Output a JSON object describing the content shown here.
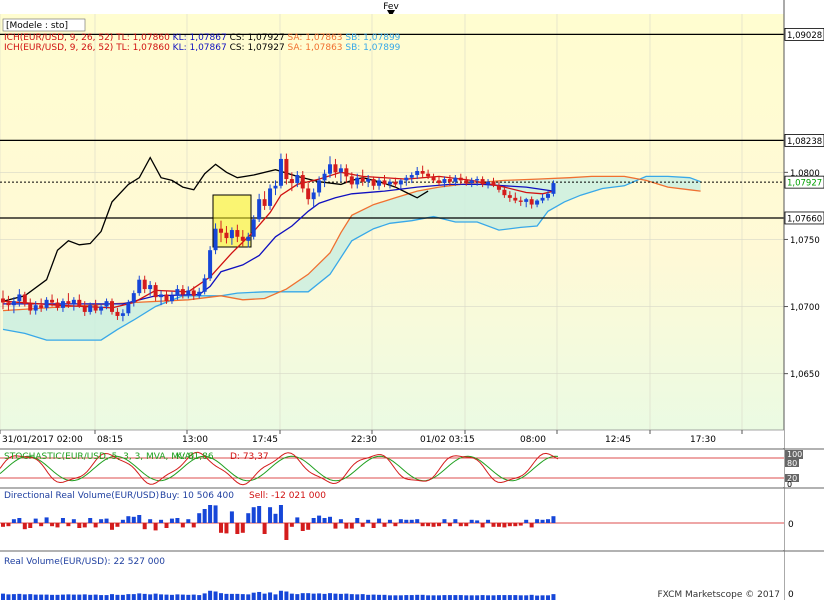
{
  "header": {
    "period_label": "Fev"
  },
  "legend": {
    "title": "[Modele : sto]",
    "line1": [
      {
        "text": "ICH(EUR/USD, 9, 26, 52)",
        "color": "#d01010"
      },
      {
        "text": "TL: 1,07860",
        "color": "#d01010"
      },
      {
        "text": "KL: 1,07867",
        "color": "#1010c0"
      },
      {
        "text": "CS: 1,07927",
        "color": "#000000"
      },
      {
        "text": "SA: 1,07863",
        "color": "#f07030"
      },
      {
        "text": "SB: 1,07899",
        "color": "#38a8e8"
      }
    ],
    "line2": [
      {
        "text": "ICH(EUR/USD, 9, 26, 52)",
        "color": "#d01010"
      },
      {
        "text": "TL: 1,07860",
        "color": "#d01010"
      },
      {
        "text": "KL: 1,07867",
        "color": "#1010c0"
      },
      {
        "text": "CS: 1,07927",
        "color": "#000000"
      },
      {
        "text": "SA: 1,07863",
        "color": "#f07030"
      },
      {
        "text": "SB: 1,07899",
        "color": "#38a8e8"
      }
    ]
  },
  "price_axis": {
    "ticks": [
      "1,0800",
      "1,0750",
      "1,0700",
      "1,0650"
    ],
    "tick_values": [
      1.08,
      1.075,
      1.07,
      1.065
    ],
    "markers": [
      {
        "label": "1,09028",
        "value": 1.09028,
        "style": "solid",
        "text_color": "#000000"
      },
      {
        "label": "1,08238",
        "value": 1.08238,
        "style": "solid",
        "text_color": "#000000"
      },
      {
        "label": "1,07927",
        "value": 1.07927,
        "style": "dotted",
        "text_color": "#00a000"
      },
      {
        "label": "1,07660",
        "value": 1.0766,
        "style": "solid",
        "text_color": "#000000"
      }
    ],
    "ylim": [
      1.0608,
      1.0918
    ]
  },
  "time_axis": {
    "labels": [
      "31/01/2017 02:00",
      "08:15",
      "13:00",
      "17:45",
      "22:30",
      "01/02 03:15",
      "08:00",
      "12:45",
      "17:30"
    ]
  },
  "stochastic": {
    "label": "STOCHASTIC(EUR/USD, 5, 3, 3, MVA, MVA)",
    "k_text": "K: 81,86",
    "d_text": "D: 73,37",
    "levels": [
      "100",
      "80",
      "20",
      "0"
    ]
  },
  "directional_volume": {
    "label": "Directional Real Volume(EUR/USD)",
    "buy_text": "Buy: 10 506 400",
    "sell_text": "Sell: -12 021 000",
    "zero_label": "0"
  },
  "real_volume": {
    "label": "Real Volume(EUR/USD): 22 527 000",
    "zero_label": "0"
  },
  "footer": {
    "copyright": "FXCM Marketscope © 2017"
  },
  "colors": {
    "bull": "#1646d8",
    "bear": "#d41c1c",
    "tenkan": "#d01010",
    "kijun": "#1010c0",
    "chikou": "#000000",
    "span_a": "#f07030",
    "span_b": "#38a8e8",
    "cloud": "#cbeee0",
    "bg_top": "#fffdd0",
    "bg_bottom": "#e9fbe4",
    "stoch_k": "#d41c1c",
    "stoch_d": "#20a020"
  },
  "chart_data": {
    "type": "candlestick",
    "symbol": "EUR/USD",
    "ylim": [
      1.0608,
      1.0918
    ],
    "candles": [
      [
        1.0706,
        1.0712,
        1.0698,
        1.0703
      ],
      [
        1.0703,
        1.0708,
        1.0697,
        1.0701
      ],
      [
        1.0701,
        1.0707,
        1.0695,
        1.0704
      ],
      [
        1.0704,
        1.0713,
        1.07,
        1.0709
      ],
      [
        1.0709,
        1.0711,
        1.07,
        1.0702
      ],
      [
        1.0702,
        1.0706,
        1.0694,
        1.0697
      ],
      [
        1.0697,
        1.0704,
        1.0694,
        1.0701
      ],
      [
        1.0701,
        1.0706,
        1.0696,
        1.0699
      ],
      [
        1.0699,
        1.0707,
        1.0697,
        1.0705
      ],
      [
        1.0705,
        1.0709,
        1.07,
        1.0703
      ],
      [
        1.0703,
        1.0706,
        1.0697,
        1.0699
      ],
      [
        1.0699,
        1.0706,
        1.0696,
        1.0704
      ],
      [
        1.0704,
        1.071,
        1.0699,
        1.0702
      ],
      [
        1.0702,
        1.0707,
        1.0697,
        1.0705
      ],
      [
        1.0705,
        1.0709,
        1.0699,
        1.07
      ],
      [
        1.07,
        1.0704,
        1.0693,
        1.0696
      ],
      [
        1.0696,
        1.0703,
        1.0694,
        1.0701
      ],
      [
        1.0701,
        1.0705,
        1.0695,
        1.0697
      ],
      [
        1.0697,
        1.0702,
        1.0694,
        1.07
      ],
      [
        1.07,
        1.0706,
        1.0698,
        1.0704
      ],
      [
        1.0704,
        1.0706,
        1.0694,
        1.0696
      ],
      [
        1.0696,
        1.0699,
        1.069,
        1.0693
      ],
      [
        1.0693,
        1.0698,
        1.0689,
        1.0695
      ],
      [
        1.0695,
        1.0705,
        1.0693,
        1.0703
      ],
      [
        1.0703,
        1.0712,
        1.07,
        1.071
      ],
      [
        1.071,
        1.0723,
        1.0708,
        1.072
      ],
      [
        1.072,
        1.0723,
        1.071,
        1.0713
      ],
      [
        1.0713,
        1.0719,
        1.0708,
        1.0716
      ],
      [
        1.0716,
        1.0718,
        1.0704,
        1.0707
      ],
      [
        1.0707,
        1.0712,
        1.0701,
        1.0709
      ],
      [
        1.0709,
        1.0712,
        1.0702,
        1.0704
      ],
      [
        1.0704,
        1.0711,
        1.0702,
        1.0708
      ],
      [
        1.0708,
        1.0716,
        1.0705,
        1.0713
      ],
      [
        1.0713,
        1.0716,
        1.0706,
        1.0709
      ],
      [
        1.0709,
        1.0715,
        1.0706,
        1.0712
      ],
      [
        1.0712,
        1.0715,
        1.0705,
        1.0708
      ],
      [
        1.0708,
        1.0714,
        1.0706,
        1.0711
      ],
      [
        1.0711,
        1.0724,
        1.0709,
        1.0721
      ],
      [
        1.0721,
        1.0745,
        1.0719,
        1.0742
      ],
      [
        1.0742,
        1.0762,
        1.0739,
        1.0758
      ],
      [
        1.0758,
        1.0764,
        1.0748,
        1.0755
      ],
      [
        1.0755,
        1.076,
        1.0747,
        1.0751
      ],
      [
        1.0751,
        1.0759,
        1.0746,
        1.0757
      ],
      [
        1.0757,
        1.0761,
        1.0748,
        1.0752
      ],
      [
        1.0752,
        1.0757,
        1.0745,
        1.0749
      ],
      [
        1.0749,
        1.0755,
        1.0744,
        1.0752
      ],
      [
        1.0752,
        1.0768,
        1.075,
        1.0765
      ],
      [
        1.0765,
        1.0784,
        1.0763,
        1.078
      ],
      [
        1.078,
        1.0786,
        1.0772,
        1.0775
      ],
      [
        1.0775,
        1.0791,
        1.0772,
        1.0788
      ],
      [
        1.0788,
        1.0794,
        1.0783,
        1.079
      ],
      [
        1.079,
        1.0814,
        1.0788,
        1.081
      ],
      [
        1.081,
        1.0814,
        1.0791,
        1.0795
      ],
      [
        1.0795,
        1.08,
        1.0786,
        1.0792
      ],
      [
        1.0792,
        1.0801,
        1.0789,
        1.0798
      ],
      [
        1.0798,
        1.0801,
        1.0785,
        1.0788
      ],
      [
        1.0788,
        1.0792,
        1.0776,
        1.078
      ],
      [
        1.078,
        1.0788,
        1.0774,
        1.0785
      ],
      [
        1.0785,
        1.0797,
        1.0782,
        1.0794
      ],
      [
        1.0794,
        1.0802,
        1.0789,
        1.0799
      ],
      [
        1.0799,
        1.0812,
        1.0796,
        1.0806
      ],
      [
        1.0806,
        1.081,
        1.0796,
        1.08
      ],
      [
        1.08,
        1.0806,
        1.0793,
        1.0803
      ],
      [
        1.0803,
        1.0806,
        1.0792,
        1.0797
      ],
      [
        1.0797,
        1.08,
        1.0788,
        1.0791
      ],
      [
        1.0791,
        1.0799,
        1.0788,
        1.0796
      ],
      [
        1.0796,
        1.0802,
        1.079,
        1.0793
      ],
      [
        1.0793,
        1.0798,
        1.0789,
        1.0795
      ],
      [
        1.0795,
        1.0797,
        1.0787,
        1.079
      ],
      [
        1.079,
        1.0796,
        1.0787,
        1.0794
      ],
      [
        1.0794,
        1.0798,
        1.0789,
        1.0791
      ],
      [
        1.0791,
        1.0795,
        1.0788,
        1.0793
      ],
      [
        1.0793,
        1.0796,
        1.0789,
        1.0791
      ],
      [
        1.0791,
        1.0795,
        1.0788,
        1.0794
      ],
      [
        1.0794,
        1.0798,
        1.079,
        1.0796
      ],
      [
        1.0796,
        1.08,
        1.0792,
        1.0798
      ],
      [
        1.0798,
        1.0804,
        1.0795,
        1.0801
      ],
      [
        1.0801,
        1.0805,
        1.0796,
        1.0799
      ],
      [
        1.0799,
        1.0802,
        1.0795,
        1.0797
      ],
      [
        1.0797,
        1.0799,
        1.0792,
        1.0794
      ],
      [
        1.0794,
        1.0797,
        1.079,
        1.0792
      ],
      [
        1.0792,
        1.0797,
        1.0789,
        1.0795
      ],
      [
        1.0795,
        1.0798,
        1.079,
        1.0793
      ],
      [
        1.0793,
        1.0798,
        1.079,
        1.0796
      ],
      [
        1.0796,
        1.0799,
        1.0791,
        1.0794
      ],
      [
        1.0794,
        1.0797,
        1.079,
        1.0792
      ],
      [
        1.0792,
        1.0796,
        1.0789,
        1.0794
      ],
      [
        1.0794,
        1.0797,
        1.079,
        1.0795
      ],
      [
        1.0795,
        1.0797,
        1.0789,
        1.0791
      ],
      [
        1.0791,
        1.0795,
        1.0788,
        1.0793
      ],
      [
        1.0793,
        1.0796,
        1.0789,
        1.079
      ],
      [
        1.079,
        1.0793,
        1.0785,
        1.0787
      ],
      [
        1.0787,
        1.0789,
        1.0781,
        1.0783
      ],
      [
        1.0783,
        1.0786,
        1.0778,
        1.0781
      ],
      [
        1.0781,
        1.0785,
        1.0777,
        1.0779
      ],
      [
        1.0779,
        1.0782,
        1.0775,
        1.0778
      ],
      [
        1.0778,
        1.0781,
        1.0774,
        1.078
      ],
      [
        1.078,
        1.0782,
        1.0773,
        1.0776
      ],
      [
        1.0776,
        1.078,
        1.0774,
        1.0779
      ],
      [
        1.0779,
        1.0784,
        1.0777,
        1.0781
      ],
      [
        1.0781,
        1.0786,
        1.0779,
        1.0784
      ],
      [
        1.0784,
        1.0794,
        1.0782,
        1.0792
      ]
    ],
    "tenkan": [
      [
        0,
        1.0704
      ],
      [
        10,
        1.0701
      ],
      [
        20,
        1.0699
      ],
      [
        24,
        1.0703
      ],
      [
        28,
        1.0712
      ],
      [
        34,
        1.0711
      ],
      [
        38,
        1.0722
      ],
      [
        40,
        1.0731
      ],
      [
        42,
        1.074
      ],
      [
        46,
        1.0756
      ],
      [
        49,
        1.077
      ],
      [
        51,
        1.0783
      ],
      [
        54,
        1.0791
      ],
      [
        58,
        1.0795
      ],
      [
        62,
        1.08
      ],
      [
        66,
        1.0797
      ],
      [
        74,
        1.0795
      ],
      [
        80,
        1.0797
      ],
      [
        86,
        1.0794
      ],
      [
        92,
        1.0789
      ],
      [
        96,
        1.0785
      ],
      [
        99,
        1.0784
      ],
      [
        101,
        1.0786
      ]
    ],
    "kijun": [
      [
        0,
        1.0702
      ],
      [
        12,
        1.0702
      ],
      [
        22,
        1.0702
      ],
      [
        24,
        1.0704
      ],
      [
        28,
        1.0708
      ],
      [
        36,
        1.0709
      ],
      [
        38,
        1.0715
      ],
      [
        40,
        1.0726
      ],
      [
        44,
        1.0731
      ],
      [
        47,
        1.0738
      ],
      [
        50,
        1.0752
      ],
      [
        53,
        1.076
      ],
      [
        56,
        1.0771
      ],
      [
        58,
        1.0777
      ],
      [
        61,
        1.0781
      ],
      [
        64,
        1.0784
      ],
      [
        70,
        1.0786
      ],
      [
        76,
        1.0789
      ],
      [
        82,
        1.0791
      ],
      [
        88,
        1.0791
      ],
      [
        92,
        1.079
      ],
      [
        96,
        1.0789
      ],
      [
        101,
        1.0786
      ]
    ],
    "chikou": [
      [
        0,
        1.0704
      ],
      [
        4,
        1.0708
      ],
      [
        8,
        1.072
      ],
      [
        10,
        1.0742
      ],
      [
        12,
        1.0749
      ],
      [
        14,
        1.0746
      ],
      [
        16,
        1.0747
      ],
      [
        18,
        1.0756
      ],
      [
        20,
        1.0778
      ],
      [
        23,
        1.0791
      ],
      [
        25,
        1.0796
      ],
      [
        27,
        1.0811
      ],
      [
        29,
        1.0796
      ],
      [
        31,
        1.0794
      ],
      [
        33,
        1.0789
      ],
      [
        35,
        1.0787
      ],
      [
        37,
        1.0799
      ],
      [
        39,
        1.0806
      ],
      [
        41,
        1.08
      ],
      [
        43,
        1.0796
      ],
      [
        46,
        1.0798
      ],
      [
        50,
        1.0802
      ],
      [
        54,
        1.0797
      ],
      [
        58,
        1.0793
      ],
      [
        62,
        1.0791
      ],
      [
        64,
        1.0794
      ],
      [
        66,
        1.0796
      ],
      [
        69,
        1.0793
      ],
      [
        72,
        1.0789
      ],
      [
        74,
        1.0785
      ],
      [
        76,
        1.0781
      ],
      [
        78,
        1.0786
      ]
    ],
    "span_a": [
      [
        0,
        1.0697
      ],
      [
        12,
        1.07
      ],
      [
        24,
        1.0703
      ],
      [
        34,
        1.0705
      ],
      [
        40,
        1.0708
      ],
      [
        44,
        1.0705
      ],
      [
        48,
        1.0706
      ],
      [
        52,
        1.0713
      ],
      [
        56,
        1.0724
      ],
      [
        60,
        1.074
      ],
      [
        62,
        1.0755
      ],
      [
        64,
        1.0768
      ],
      [
        68,
        1.0776
      ],
      [
        72,
        1.0781
      ],
      [
        76,
        1.0786
      ],
      [
        80,
        1.0789
      ],
      [
        86,
        1.0792
      ],
      [
        92,
        1.0794
      ],
      [
        98,
        1.0795
      ],
      [
        104,
        1.0796
      ],
      [
        108,
        1.0797
      ],
      [
        114,
        1.0797
      ],
      [
        118,
        1.0794
      ],
      [
        122,
        1.0789
      ],
      [
        126,
        1.0787
      ],
      [
        128,
        1.0786
      ]
    ],
    "span_b": [
      [
        0,
        1.0683
      ],
      [
        4,
        1.068
      ],
      [
        8,
        1.0675
      ],
      [
        13,
        1.0675
      ],
      [
        18,
        1.0675
      ],
      [
        21,
        1.0683
      ],
      [
        24,
        1.069
      ],
      [
        28,
        1.07
      ],
      [
        33,
        1.0708
      ],
      [
        40,
        1.0708
      ],
      [
        43,
        1.071
      ],
      [
        48,
        1.0711
      ],
      [
        56,
        1.0711
      ],
      [
        60,
        1.0724
      ],
      [
        64,
        1.0749
      ],
      [
        68,
        1.0758
      ],
      [
        71,
        1.0762
      ],
      [
        75,
        1.0764
      ],
      [
        79,
        1.0767
      ],
      [
        83,
        1.0763
      ],
      [
        87,
        1.0763
      ],
      [
        91,
        1.0757
      ],
      [
        95,
        1.0759
      ],
      [
        98,
        1.076
      ],
      [
        100,
        1.0771
      ],
      [
        103,
        1.0778
      ],
      [
        106,
        1.0783
      ],
      [
        110,
        1.0788
      ],
      [
        114,
        1.079
      ],
      [
        118,
        1.0797
      ],
      [
        122,
        1.0797
      ],
      [
        126,
        1.0796
      ],
      [
        128,
        1.0793
      ]
    ],
    "stochastic_k": [],
    "stochastic_d": [],
    "directional_volume": [],
    "real_volume": []
  }
}
